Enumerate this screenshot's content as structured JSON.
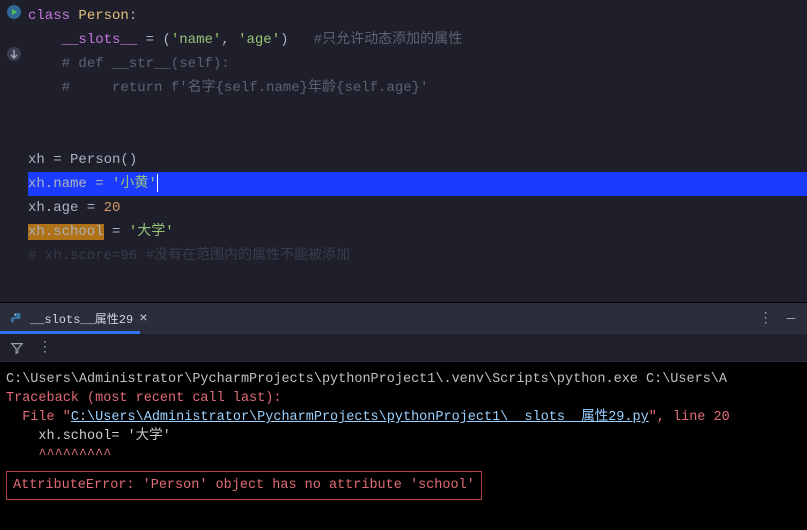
{
  "editor": {
    "lines": {
      "l1_keyword": "class ",
      "l1_classname": "Person",
      "l1_colon": ":",
      "l2_slots": "__slots__",
      "l2_eq": " = ",
      "l2_p_open": "(",
      "l2_s1": "'name'",
      "l2_comma": ", ",
      "l2_s2": "'age'",
      "l2_p_close": ")",
      "l2_comment": "   #只允许动态添加的属性",
      "l3_comment": "# def __str__(self):",
      "l4_comment": "#     return f'名字{self.name}年龄{self.age}'",
      "l7": "xh = Person()",
      "l8_a": "xh.name = ",
      "l8_b": "'小黄'",
      "l9_a": "xh.age = ",
      "l9_b": "20",
      "l10_a": "xh.school",
      "l10_b": " = ",
      "l10_c": "'大学'",
      "l11_dim": "# xh.score=96 #没有在范围内的属性不能被添加"
    }
  },
  "tab": {
    "label": "__slots__属性29"
  },
  "console": {
    "cmd": "C:\\Users\\Administrator\\PycharmProjects\\pythonProject1\\.venv\\Scripts\\python.exe C:\\Users\\A",
    "trace_head": "Traceback (most recent call last):",
    "file_indent": "  File \"",
    "file_path": "C:\\Users\\Administrator\\PycharmProjects\\pythonProject1\\__slots__属性29.py",
    "file_tail": "\", line 20",
    "code_line": "    xh.school= '大学'",
    "caret_line": "    ^^^^^^^^^",
    "error": "AttributeError: 'Person' object has no attribute 'school'"
  }
}
